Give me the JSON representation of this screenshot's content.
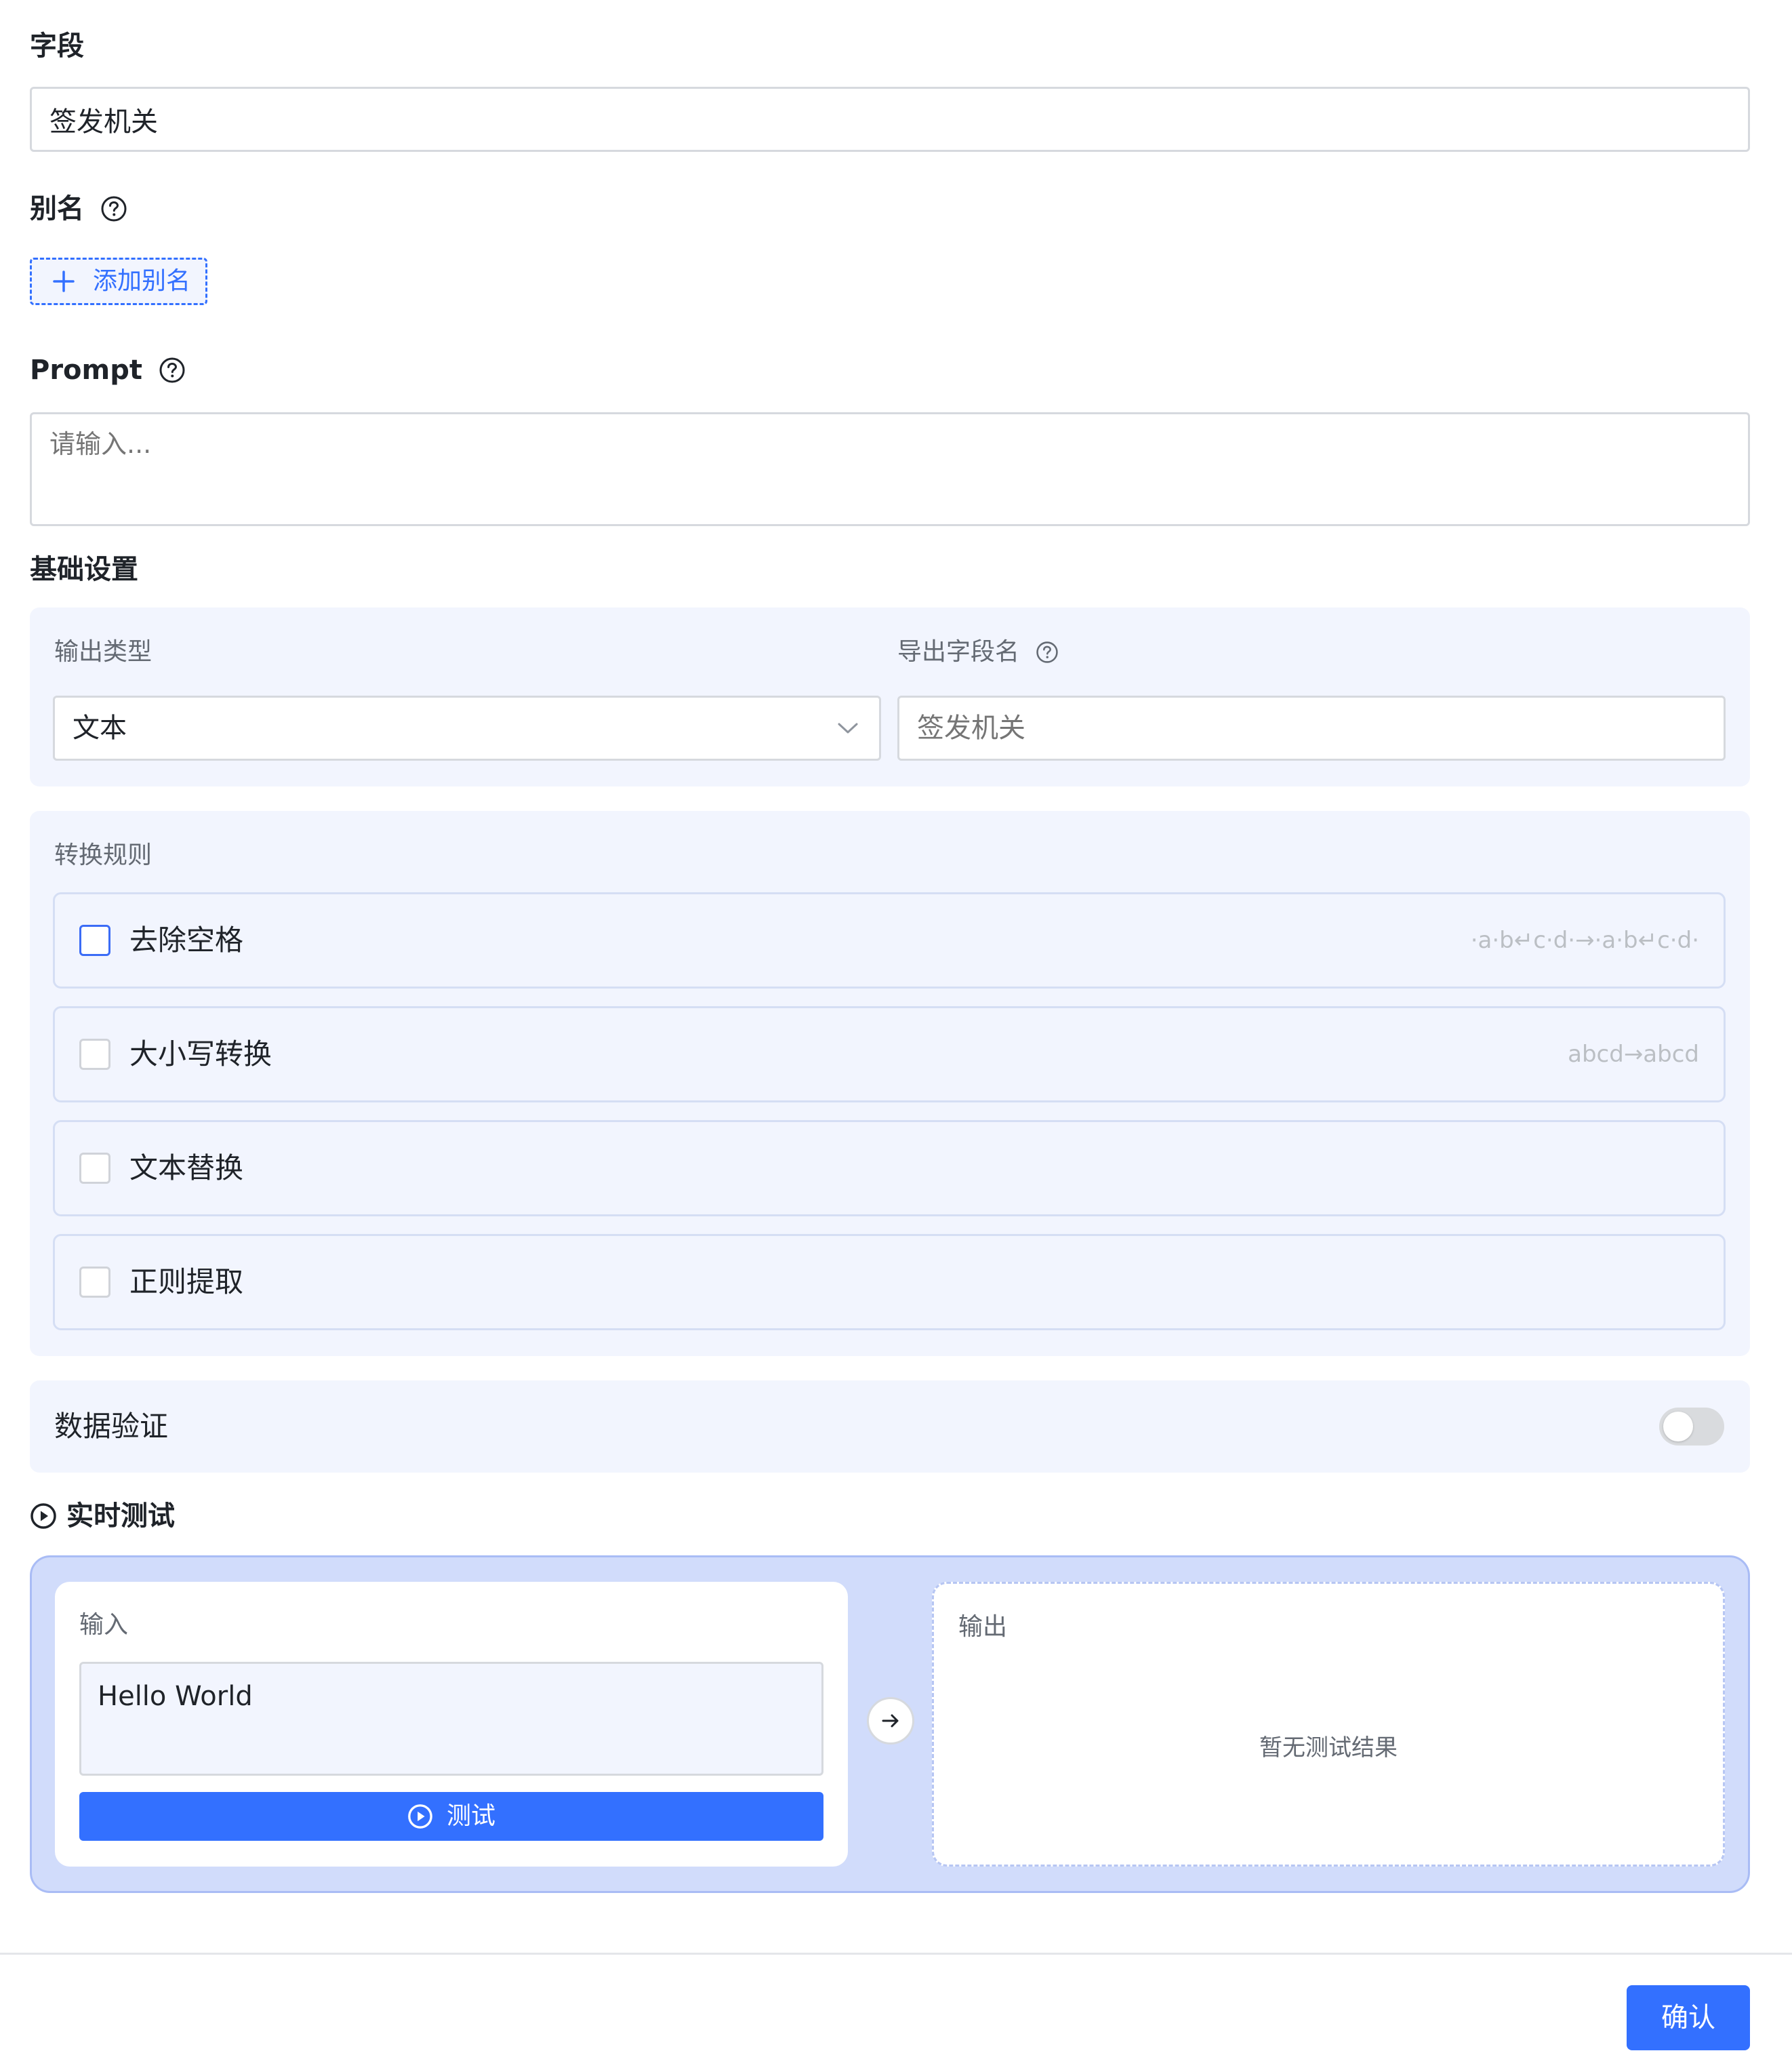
{
  "field": {
    "label": "字段",
    "value": "签发机关"
  },
  "alias": {
    "label": "别名",
    "add_button": "添加别名"
  },
  "prompt": {
    "label": "Prompt",
    "placeholder": "请输入..."
  },
  "basic_settings": {
    "title": "基础设置",
    "output_type_label": "输出类型",
    "output_type_value": "文本",
    "export_field_label": "导出字段名",
    "export_field_placeholder": "签发机关"
  },
  "transform_rules": {
    "title": "转换规则",
    "rules": [
      {
        "label": "去除空格",
        "example": "·a·b↵c·d·→·a·b↵c·d·",
        "checked": false,
        "focused": true
      },
      {
        "label": "大小写转换",
        "example": "abcd→abcd",
        "checked": false,
        "focused": false
      },
      {
        "label": "文本替换",
        "example": "",
        "checked": false,
        "focused": false
      },
      {
        "label": "正则提取",
        "example": "",
        "checked": false,
        "focused": false
      }
    ]
  },
  "validation": {
    "label": "数据验证",
    "enabled": false
  },
  "live_test": {
    "title": "实时测试",
    "input_label": "输入",
    "input_value": "Hello World",
    "test_button": "测试",
    "output_label": "输出",
    "output_empty": "暂无测试结果"
  },
  "footer": {
    "confirm_button": "确认"
  },
  "colors": {
    "primary": "#3370ff",
    "panel_bg": "#f2f5fe",
    "test_bg": "#d1dcfb"
  }
}
